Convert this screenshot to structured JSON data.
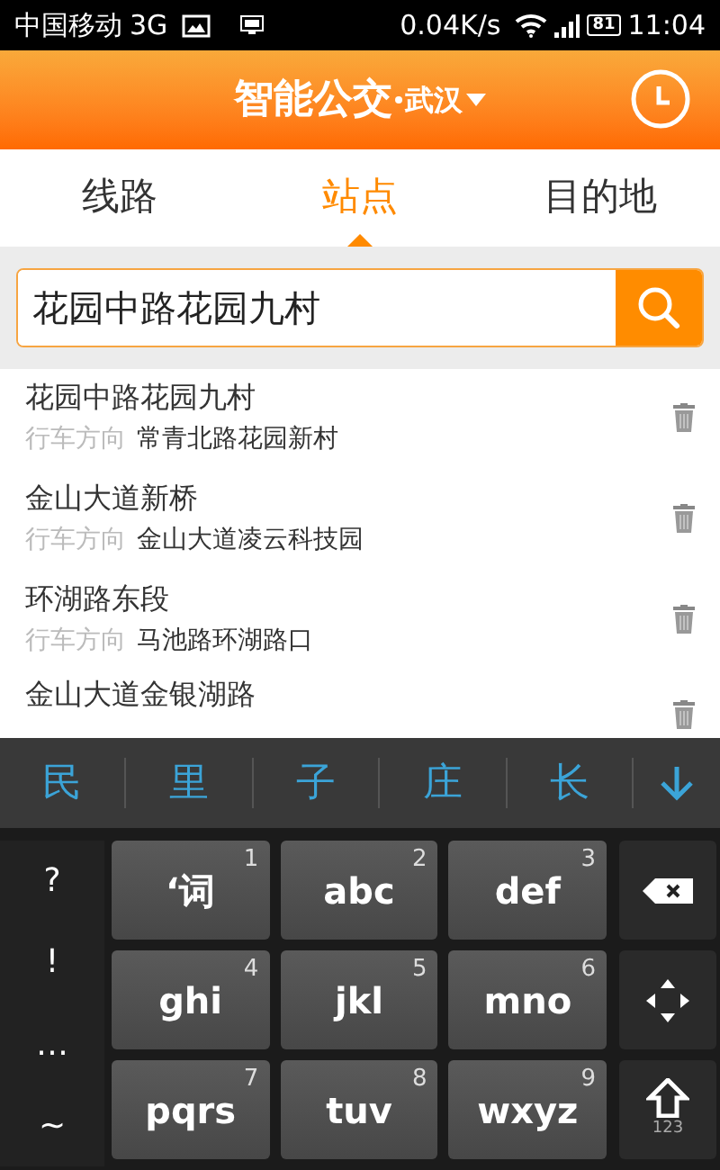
{
  "status_bar": {
    "carrier": "中国移动",
    "network": "3G",
    "speed": "0.04K/s",
    "battery": "81",
    "time": "11:04"
  },
  "header": {
    "title": "智能公交",
    "city": "武汉"
  },
  "tabs": [
    {
      "label": "线路",
      "selected": false
    },
    {
      "label": "站点",
      "selected": true
    },
    {
      "label": "目的地",
      "selected": false
    }
  ],
  "search": {
    "value": "花园中路花园九村"
  },
  "stops": [
    {
      "name": "花园中路花园九村",
      "direction_label": "行车方向",
      "direction": "常青北路花园新村"
    },
    {
      "name": "金山大道新桥",
      "direction_label": "行车方向",
      "direction": "金山大道凌云科技园"
    },
    {
      "name": "环湖路东段",
      "direction_label": "行车方向",
      "direction": "马池路环湖路口"
    },
    {
      "name": "金山大道金银湖路"
    }
  ],
  "keyboard": {
    "candidates": [
      "民",
      "里",
      "子",
      "庄",
      "长"
    ],
    "symbols": [
      "?",
      "!",
      "…",
      "~"
    ],
    "keys": [
      {
        "label": "‘词",
        "number": "1"
      },
      {
        "label": "abc",
        "number": "2"
      },
      {
        "label": "def",
        "number": "3"
      },
      {
        "label": "ghi",
        "number": "4"
      },
      {
        "label": "jkl",
        "number": "5"
      },
      {
        "label": "mno",
        "number": "6"
      },
      {
        "label": "pqrs",
        "number": "7"
      },
      {
        "label": "tuv",
        "number": "8"
      },
      {
        "label": "wxyz",
        "number": "9"
      }
    ],
    "shift_sublabel": "123"
  }
}
